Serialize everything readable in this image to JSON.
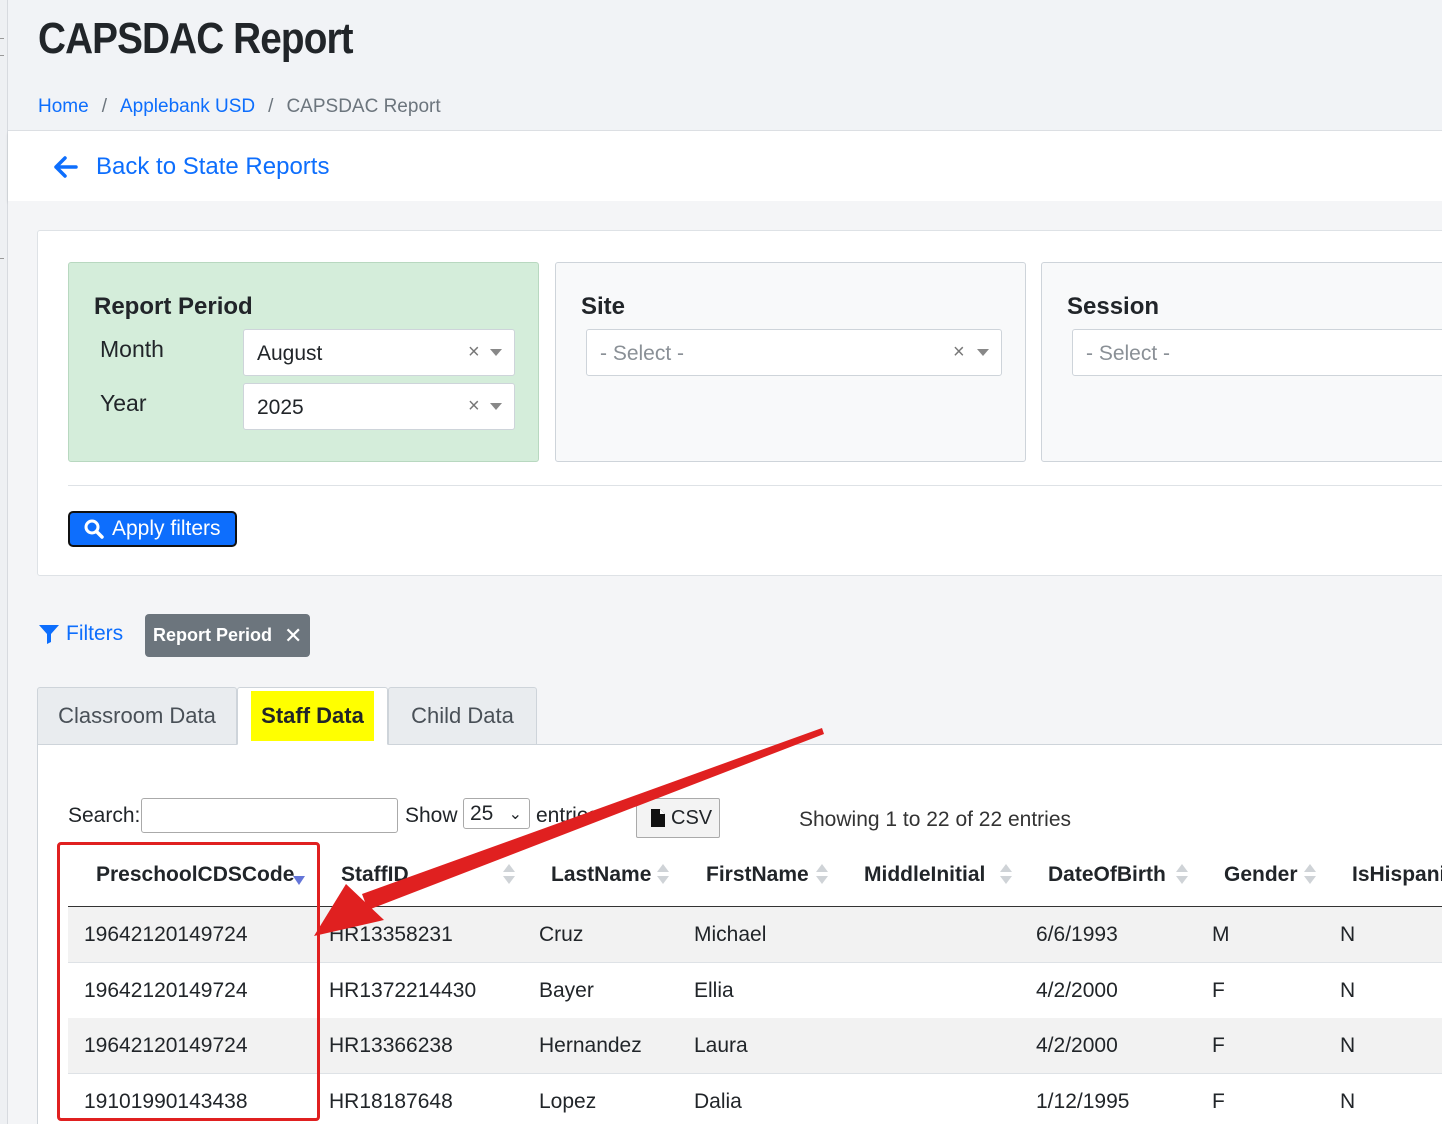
{
  "header": {
    "title": "CAPSDAC Report",
    "breadcrumb": [
      "Home",
      "Applebank USD",
      "CAPSDAC Report"
    ]
  },
  "back_link": "Back to State Reports",
  "filters": {
    "report_period": {
      "title": "Report Period",
      "month_label": "Month",
      "month_value": "August",
      "year_label": "Year",
      "year_value": "2025"
    },
    "site": {
      "title": "Site",
      "placeholder": "- Select -"
    },
    "session": {
      "title": "Session",
      "placeholder": "- Select -"
    },
    "apply_label": "Apply filters"
  },
  "active_filters": {
    "link_label": "Filters",
    "chip_label": "Report Period"
  },
  "tabs": [
    {
      "label": "Classroom Data",
      "active": false
    },
    {
      "label": "Staff Data",
      "active": true
    },
    {
      "label": "Child Data",
      "active": false
    }
  ],
  "table_controls": {
    "search_label": "Search:",
    "show_label": "Show",
    "page_length": "25",
    "entries_label": "entries",
    "csv_label": "CSV",
    "info": "Showing 1 to 22 of 22 entries"
  },
  "table": {
    "columns": [
      "PreschoolCDSCode",
      "StaffID",
      "LastName",
      "FirstName",
      "MiddleInitial",
      "DateOfBirth",
      "Gender",
      "IsHispani"
    ],
    "rows": [
      [
        "19642120149724",
        "HR13358231",
        "Cruz",
        "Michael",
        "",
        "6/6/1993",
        "M",
        "N"
      ],
      [
        "19642120149724",
        "HR1372214430",
        "Bayer",
        "Ellia",
        "",
        "4/2/2000",
        "F",
        "N"
      ],
      [
        "19642120149724",
        "HR13366238",
        "Hernandez",
        "Laura",
        "",
        "4/2/2000",
        "F",
        "N"
      ],
      [
        "19101990143438",
        "HR18187648",
        "Lopez",
        "Dalia",
        "",
        "1/12/1995",
        "F",
        "N"
      ]
    ]
  },
  "colors": {
    "primary": "#0d6efd",
    "active_filter_bg": "#d4edda",
    "tab_highlight": "#ffff00",
    "annotation_red": "#e02020",
    "chip_bg": "#6c757d"
  }
}
